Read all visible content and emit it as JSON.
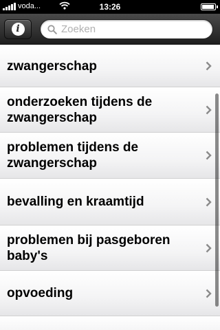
{
  "status": {
    "carrier": "voda",
    "time": "13:26"
  },
  "toolbar": {
    "info_label": "i"
  },
  "search": {
    "placeholder": "Zoeken"
  },
  "list": {
    "items": [
      {
        "label": "zwangerschap"
      },
      {
        "label": "onderzoeken tijdens de zwangerschap"
      },
      {
        "label": "problemen tijdens de zwangerschap"
      },
      {
        "label": "bevalling en kraamtijd"
      },
      {
        "label": "problemen bij pasgeboren baby's"
      },
      {
        "label": "opvoeding"
      }
    ]
  },
  "colors": {
    "toolbar": "#2e2e2e",
    "row_top": "#ffffff",
    "row_bottom": "#e6e6e8",
    "chevron": "#8a8a8a"
  },
  "icons": [
    "signal-bars-icon",
    "wifi-icon",
    "battery-icon",
    "info-icon",
    "search-icon",
    "chevron-right-icon"
  ]
}
